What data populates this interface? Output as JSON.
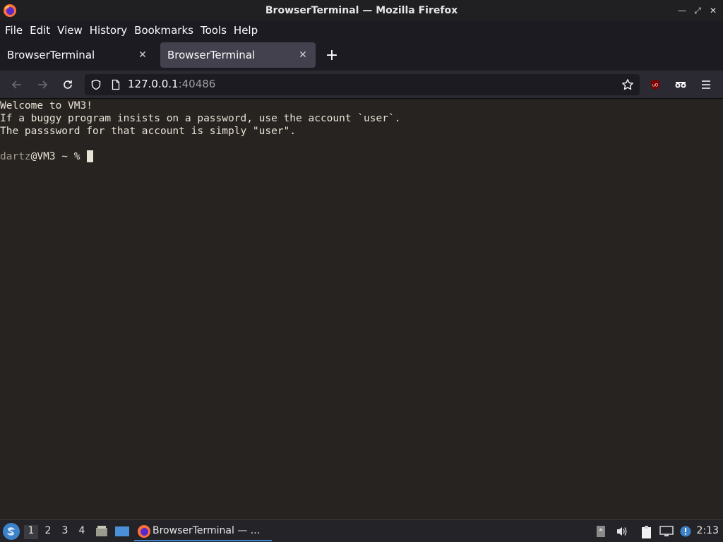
{
  "window": {
    "title": "BrowserTerminal — Mozilla Firefox"
  },
  "menubar": {
    "items": [
      {
        "label": "File"
      },
      {
        "label": "Edit"
      },
      {
        "label": "View"
      },
      {
        "label": "History"
      },
      {
        "label": "Bookmarks"
      },
      {
        "label": "Tools"
      },
      {
        "label": "Help"
      }
    ]
  },
  "tabs": [
    {
      "label": "BrowserTerminal",
      "active": false
    },
    {
      "label": "BrowserTerminal",
      "active": true
    }
  ],
  "urlbar": {
    "host": "127.0.0.1",
    "port": ":40486"
  },
  "terminal": {
    "lines": [
      "Welcome to VM3!",
      "If a buggy program insists on a password, use the account `user`.",
      "The passsword for that account is simply \"user\".",
      ""
    ],
    "prompt_user": "dartz",
    "prompt_rest": "@VM3 ~ % "
  },
  "taskbar": {
    "workspaces": [
      "1",
      "2",
      "3",
      "4"
    ],
    "current_workspace": "1",
    "app_label": "BrowserTerminal — ...",
    "clock": "2:13"
  },
  "colors": {
    "terminal_bg": "#272320",
    "terminal_fg": "#e8e2d6",
    "accent": "#3d82c8"
  }
}
